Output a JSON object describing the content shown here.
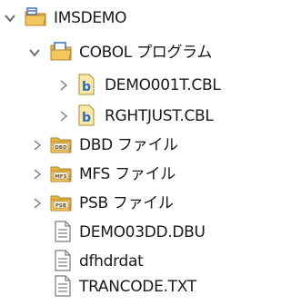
{
  "tree": {
    "project": {
      "label": "IMSDEMO",
      "icon": "project-folder-icon",
      "expanded": true
    },
    "cobol": {
      "label": "COBOL プログラム",
      "icon": "folder-icon",
      "expanded": true
    },
    "files": [
      {
        "label": "DEMO001T.CBL",
        "icon": "cobol-file-icon"
      },
      {
        "label": "RGHTJUST.CBL",
        "icon": "cobol-file-icon"
      }
    ],
    "dbd": {
      "label": "DBD ファイル",
      "icon": "dbd-folder-icon",
      "badge": "DBD",
      "expanded": false
    },
    "mfs": {
      "label": "MFS ファイル",
      "icon": "mfs-folder-icon",
      "badge": "MFS",
      "expanded": false
    },
    "psb": {
      "label": "PSB ファイル",
      "icon": "psb-folder-icon",
      "badge": "PSB",
      "expanded": false
    },
    "docs": [
      {
        "label": "DEMO03DD.DBU",
        "icon": "text-file-icon"
      },
      {
        "label": "dfhdrdat",
        "icon": "text-file-icon"
      },
      {
        "label": "TRANCODE.TXT",
        "icon": "text-file-icon"
      }
    ],
    "colors": {
      "folder": "#e9b94a",
      "project_blue": "#3a6fc4",
      "chevron": "#6b6b6b",
      "cobol_file_mark": "#2a6bd1"
    }
  }
}
